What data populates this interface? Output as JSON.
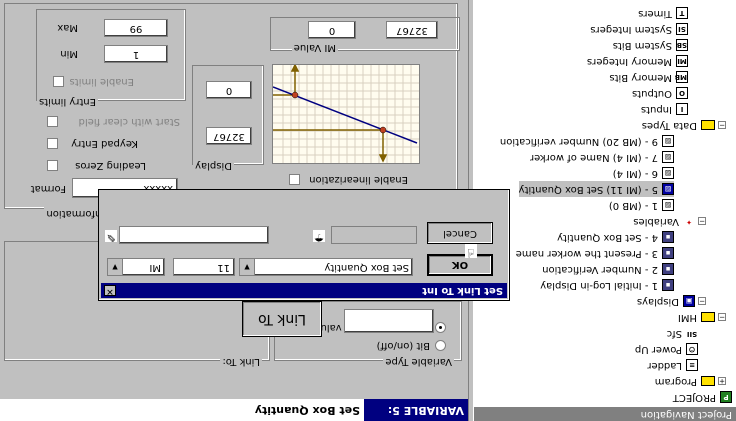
{
  "nav": {
    "title": "Project Navigation",
    "root": "PROJECT",
    "items": [
      {
        "label": "Program",
        "icon": "folder-icon"
      },
      {
        "label": "Ladder",
        "icon": "ladder-icon"
      },
      {
        "label": "Power Up",
        "icon": "power-up-icon"
      },
      {
        "label": "Sfc",
        "icon": "sfc-icon"
      },
      {
        "label": "HMI",
        "icon": "folder-icon"
      },
      {
        "label": "Displays",
        "icon": "displays-icon"
      },
      {
        "label": "1 - Initial Log-in Display",
        "icon": "display-icon"
      },
      {
        "label": "2 - Number Verification",
        "icon": "display-icon"
      },
      {
        "label": "3 - Present the worker name",
        "icon": "display-icon"
      },
      {
        "label": "4 - Set Box Quantity",
        "icon": "display-icon"
      },
      {
        "label": "Variables",
        "icon": "variables-icon"
      },
      {
        "label": "1 - (MB 0)",
        "icon": "variable-icon"
      },
      {
        "label": "5 - (MI 11) Set Box Quantity",
        "icon": "variable-icon"
      },
      {
        "label": "6 - (MI 4)",
        "icon": "variable-icon"
      },
      {
        "label": "7 - (MI 4) Name of worker",
        "icon": "variable-icon"
      },
      {
        "label": "9 - (MB 20) Number verification",
        "icon": "variable-icon"
      },
      {
        "label": "Data Types",
        "icon": "folder-icon"
      },
      {
        "label": "Inputs",
        "icon": "I"
      },
      {
        "label": "Outputs",
        "icon": "O"
      },
      {
        "label": "Memory Bits",
        "icon": "MB"
      },
      {
        "label": "Memory Integers",
        "icon": "MI"
      },
      {
        "label": "System Bits",
        "icon": "SB"
      },
      {
        "label": "System Integers",
        "icon": "SI"
      },
      {
        "label": "Timers",
        "icon": "T"
      }
    ]
  },
  "header": {
    "tab": "VARIABLE 5:",
    "name": "Set Box Quantity"
  },
  "variable_type": {
    "title": "Variable Type",
    "options": [
      "Integer (Numeric value)",
      "Bit (on/off)"
    ]
  },
  "link_to": {
    "title": "Link To:",
    "button": "Link To"
  },
  "variable_info": {
    "title": "Variable Information",
    "format_label": "Format",
    "format_value": "xxxxx",
    "leading_zeros": "Leading Zeros",
    "keypad_entry": "Keypad Entry",
    "start_clear": "Start with clear field",
    "entry_limits_title": "Entry limits",
    "enable_limits": "Enable limits",
    "min_label": "Min",
    "min_value": "1",
    "max_label": "Max",
    "max_value": "99"
  },
  "display": {
    "title": "Display",
    "top_value": "0",
    "bottom_value": "32767"
  },
  "mi_value": {
    "title": "MI Value",
    "left": "0",
    "right": "32767"
  },
  "enable_linearization": "Enable linearization",
  "dialog": {
    "title": "Set Link To Int",
    "type_value": "MI",
    "number_value": "11",
    "name_value": "Set Box Quantity",
    "ok": "OK",
    "cancel": "Cancel"
  },
  "colors": {
    "title_bar": "#000080",
    "face": "#c0c0c0",
    "folder": "#ffe100",
    "graph_line": "#000080",
    "graph_axis": "#806000",
    "graph_point": "#c04020"
  }
}
